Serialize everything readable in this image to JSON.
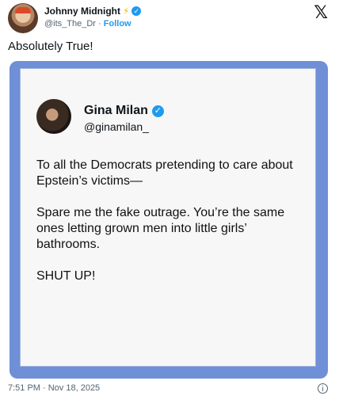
{
  "author": {
    "name": "Johnny Midnight",
    "emoji": "⚡",
    "verified_mark": "✓",
    "handle": "@its_The_Dr",
    "separator": "·",
    "follow_label": "Follow",
    "avatar_icon": "profile-photo"
  },
  "brand_logo": "𝕏",
  "tweet_text": "Absolutely True!",
  "quoted_post": {
    "name": "Gina Milan",
    "verified_mark": "✓",
    "handle": "@ginamilan_",
    "paragraphs": [
      "To all the Democrats pretending to care about Epstein’s victims—",
      "Spare me the fake outrage. You’re the same ones letting grown men into little girls’ bathrooms.",
      "SHUT UP!"
    ]
  },
  "timestamp": "7:51 PM · Nov 18, 2025",
  "info_icon": "i",
  "colors": {
    "accent": "#1d9bf0",
    "frame": "#6f8fd6",
    "muted": "#536471"
  }
}
